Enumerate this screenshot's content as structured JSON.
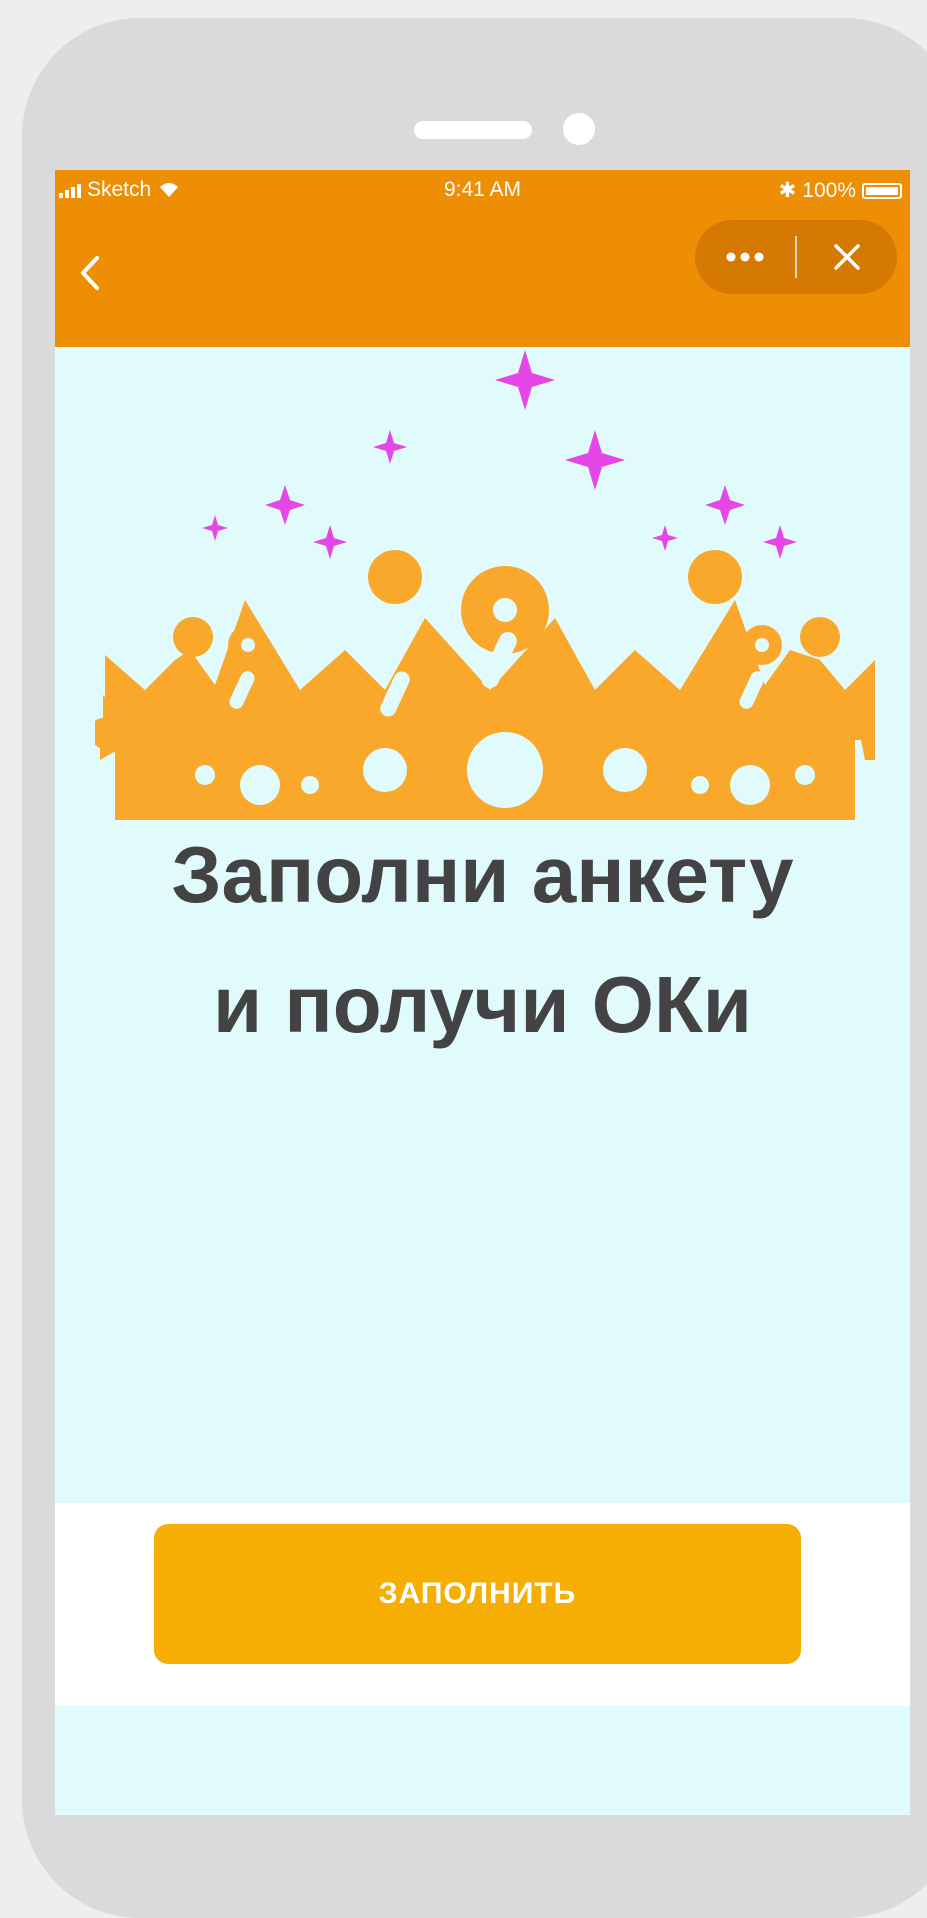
{
  "status_bar": {
    "carrier": "Sketch",
    "time": "9:41 AM",
    "battery": "100%"
  },
  "header": {
    "back_icon": "chevron-left-icon",
    "more_icon": "more-dots-icon",
    "close_icon": "close-icon",
    "color": "#ed8e05"
  },
  "main": {
    "illustration": "crown-icon",
    "headline_line1": "Заполни анкету",
    "headline_line2": "и получи ОКи",
    "background": "#e1fbfc"
  },
  "footer": {
    "button_label": "ЗАПОЛНИТЬ",
    "button_color": "#f6ae05"
  },
  "colors": {
    "crown": "#f9a82c",
    "sparkle": "#e546e6",
    "text": "#434343"
  }
}
